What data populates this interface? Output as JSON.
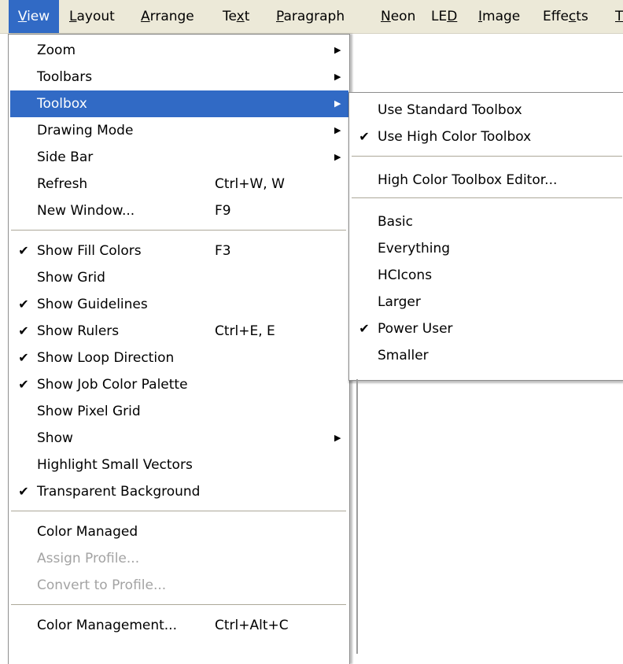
{
  "menubar": {
    "items": [
      {
        "pre": "",
        "ul": "V",
        "post": "iew"
      },
      {
        "pre": "",
        "ul": "L",
        "post": "ayout"
      },
      {
        "pre": "",
        "ul": "A",
        "post": "rrange"
      },
      {
        "pre": "Te",
        "ul": "x",
        "post": "t"
      },
      {
        "pre": "",
        "ul": "P",
        "post": "aragraph"
      },
      {
        "pre": "",
        "ul": "N",
        "post": "eon"
      },
      {
        "pre": "LE",
        "ul": "D",
        "post": ""
      },
      {
        "pre": "",
        "ul": "I",
        "post": "mage"
      },
      {
        "pre": "Effe",
        "ul": "c",
        "post": "ts"
      },
      {
        "pre": "",
        "ul": "T",
        "post": ""
      }
    ]
  },
  "view_menu": {
    "items": [
      {
        "label": "Zoom",
        "shortcut": "",
        "submenu": true,
        "checked": false
      },
      {
        "label": "Toolbars",
        "shortcut": "",
        "submenu": true,
        "checked": false
      },
      {
        "label": "Toolbox",
        "shortcut": "",
        "submenu": true,
        "checked": false,
        "highlighted": true
      },
      {
        "label": "Drawing Mode",
        "shortcut": "",
        "submenu": true,
        "checked": false
      },
      {
        "label": "Side Bar",
        "shortcut": "",
        "submenu": true,
        "checked": false
      },
      {
        "label": "Refresh",
        "shortcut": "Ctrl+W, W",
        "submenu": false,
        "checked": false
      },
      {
        "label": "New Window...",
        "shortcut": "F9",
        "submenu": false,
        "checked": false
      },
      {
        "label": "Show Fill Colors",
        "shortcut": "F3",
        "submenu": false,
        "checked": true
      },
      {
        "label": "Show Grid",
        "shortcut": "",
        "submenu": false,
        "checked": false
      },
      {
        "label": "Show Guidelines",
        "shortcut": "",
        "submenu": false,
        "checked": true
      },
      {
        "label": "Show Rulers",
        "shortcut": "Ctrl+E, E",
        "submenu": false,
        "checked": true
      },
      {
        "label": "Show Loop Direction",
        "shortcut": "",
        "submenu": false,
        "checked": true
      },
      {
        "label": "Show Job Color Palette",
        "shortcut": "",
        "submenu": false,
        "checked": true
      },
      {
        "label": "Show Pixel Grid",
        "shortcut": "",
        "submenu": false,
        "checked": false
      },
      {
        "label": "Show",
        "shortcut": "",
        "submenu": true,
        "checked": false
      },
      {
        "label": "Highlight Small Vectors",
        "shortcut": "",
        "submenu": false,
        "checked": false
      },
      {
        "label": "Transparent Background",
        "shortcut": "",
        "submenu": false,
        "checked": true
      },
      {
        "label": "Color Managed",
        "shortcut": "",
        "submenu": false,
        "checked": false
      },
      {
        "label": "Assign Profile...",
        "shortcut": "",
        "submenu": false,
        "checked": false,
        "disabled": true
      },
      {
        "label": "Convert to Profile...",
        "shortcut": "",
        "submenu": false,
        "checked": false,
        "disabled": true
      },
      {
        "label": "Color Management...",
        "shortcut": "Ctrl+Alt+C",
        "submenu": false,
        "checked": false
      }
    ]
  },
  "toolbox_submenu": {
    "items": [
      {
        "label": "Use Standard Toolbox",
        "checked": false
      },
      {
        "label": "Use High Color Toolbox",
        "checked": true
      },
      {
        "label": "High Color Toolbox Editor...",
        "checked": false
      },
      {
        "label": "Basic",
        "checked": false
      },
      {
        "label": "Everything",
        "checked": false
      },
      {
        "label": "HCIcons",
        "checked": false
      },
      {
        "label": "Larger",
        "checked": false
      },
      {
        "label": "Power User",
        "checked": true
      },
      {
        "label": "Smaller",
        "checked": false
      }
    ]
  },
  "glyphs": {
    "check": "✔",
    "arrow": "▶"
  },
  "colors": {
    "highlight": "#316ac5",
    "menubar_bg": "#ece9d8",
    "disabled_text": "#a3a3a3"
  }
}
